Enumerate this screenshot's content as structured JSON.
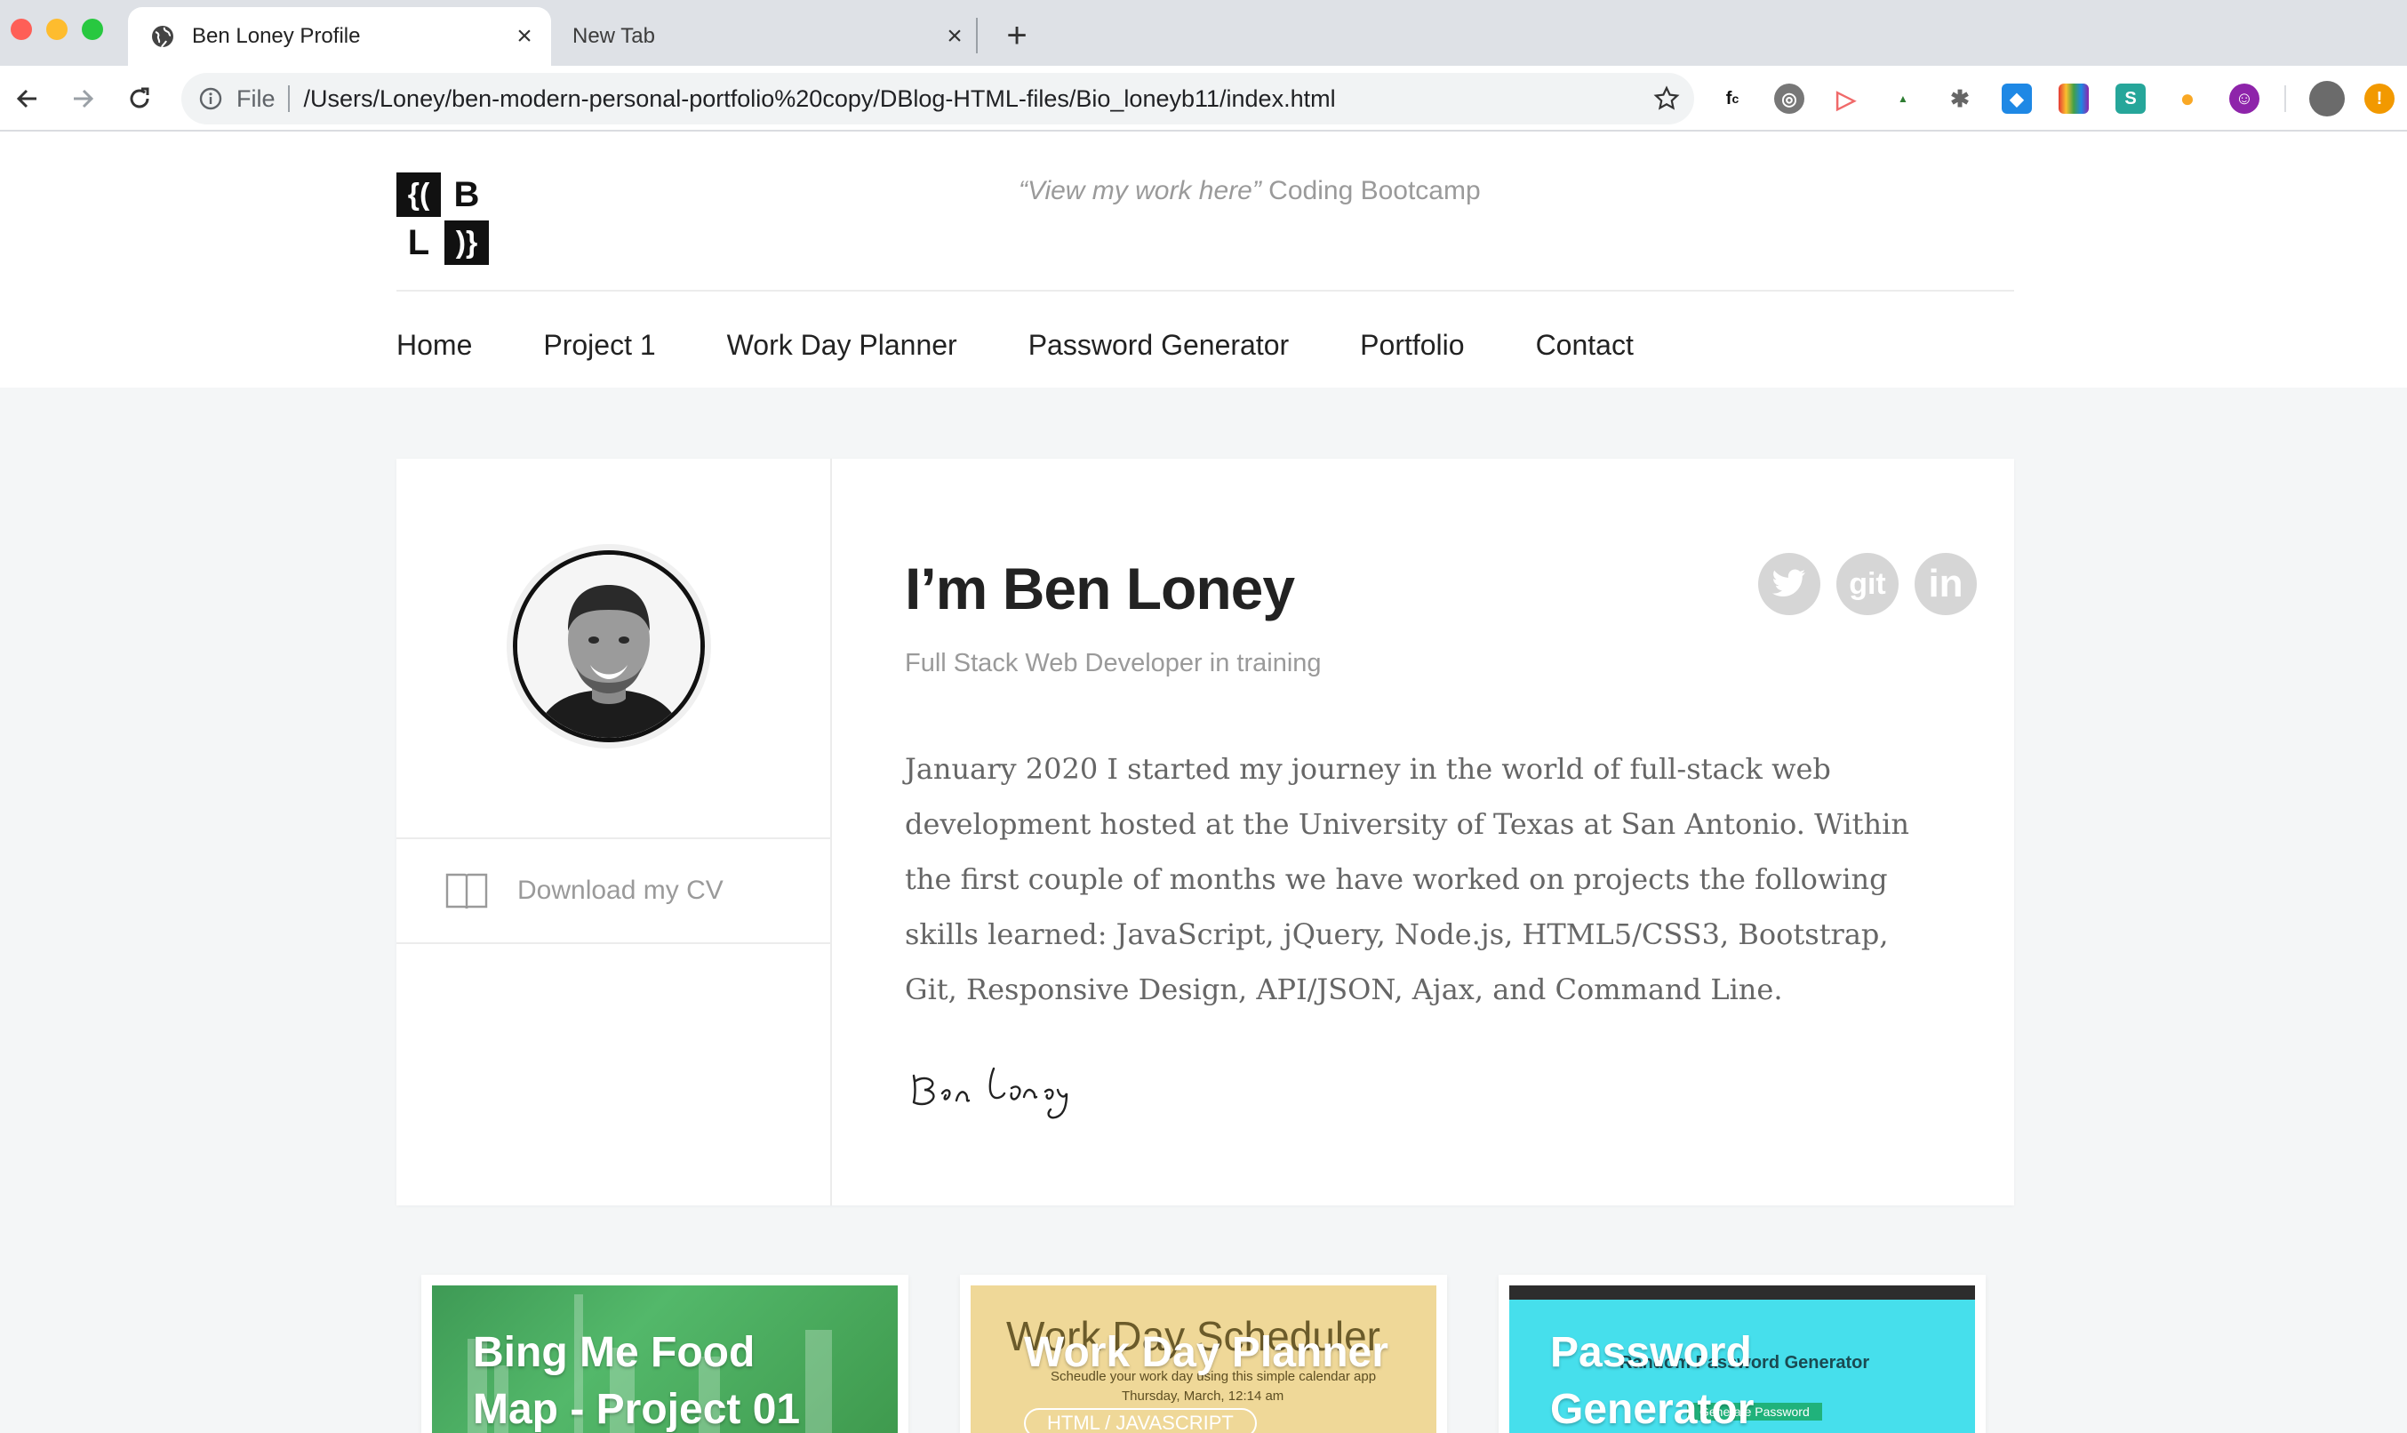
{
  "browser": {
    "tabs": [
      {
        "title": "Ben Loney Profile",
        "active": true
      },
      {
        "title": "New Tab",
        "active": false
      }
    ],
    "address": {
      "scheme": "File",
      "url": "/Users/Loney/ben-modern-personal-portfolio%20copy/DBlog-HTML-files/Bio_loneyb11/index.html"
    },
    "extensions": [
      "fc-ext",
      "globe-ext",
      "cast-ext",
      "html-tree-ext",
      "bug-ext",
      "shield-ext",
      "colors-ext",
      "s-ext",
      "bulb-ext",
      "mask-ext"
    ]
  },
  "site": {
    "logo_letters": [
      "{(",
      "B",
      "L",
      ")}"
    ],
    "tagline_quote": "“View my work here”",
    "tagline_rest": " Coding Bootcamp",
    "nav": [
      "Home",
      "Project 1",
      "Work Day Planner",
      "Password Generator",
      "Portfolio",
      "Contact"
    ]
  },
  "profile": {
    "name": "I’m Ben Loney",
    "role": "Full Stack Web Developer in training",
    "bio": "January 2020 I started my journey in the world of full-stack web development hosted at the University of Texas at San Antonio. Within the first couple of months we have worked on projects the following skills learned: JavaScript, jQuery, Node.js, HTML5/CSS3, Bootstrap, Git, Responsive Design, API/JSON, Ajax, and Command Line.",
    "cv_label": "Download my CV",
    "signature": "Ben Loney",
    "social": [
      {
        "name": "twitter",
        "label": ""
      },
      {
        "name": "git",
        "label": "git"
      },
      {
        "name": "linkedin",
        "label": "in"
      }
    ]
  },
  "projects": [
    {
      "title_line1": "Bing Me Food",
      "title_line2": "Map - Project 01"
    },
    {
      "title_line1": "Work Day Planner",
      "title_line2": "",
      "screenshot_heading": "Work Day Scheduler",
      "screenshot_sub": "Scheudle your work day using this simple calendar app",
      "screenshot_date": "Thursday, March, 12:14 am",
      "screenshot_pill": "HTML / JAVASCRIPT"
    },
    {
      "title_line1": "Password",
      "title_line2": "Generator",
      "screenshot_sub": "Random Password Generator",
      "screenshot_button": "Generate Password"
    }
  ]
}
